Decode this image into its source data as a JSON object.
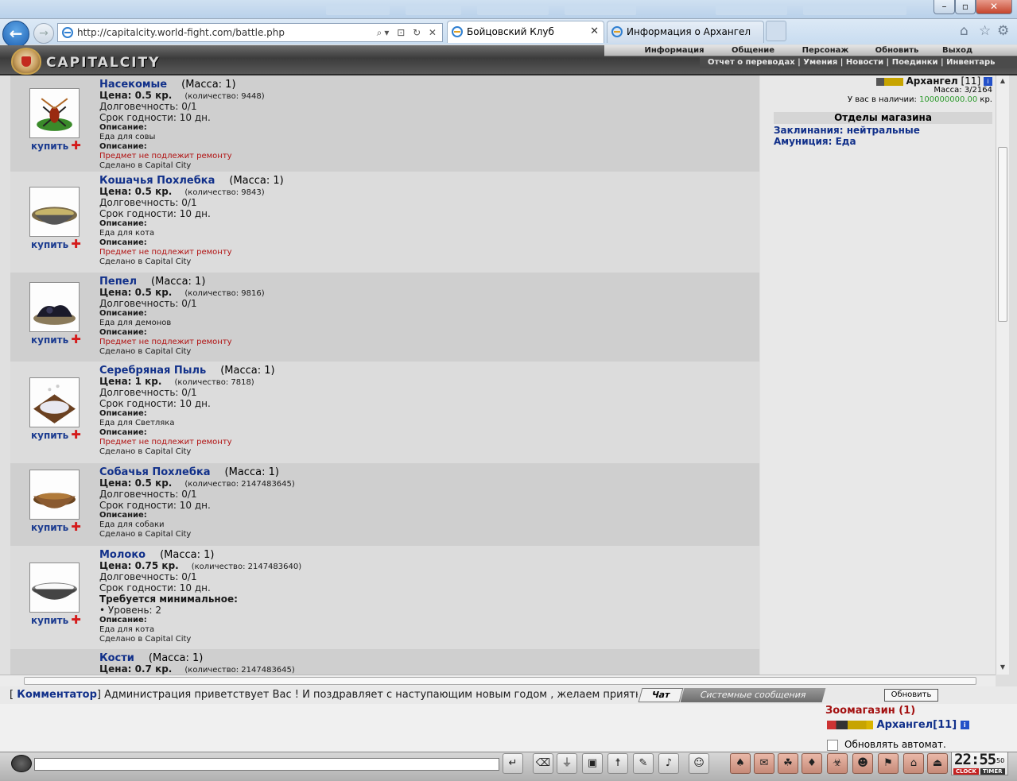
{
  "browser": {
    "address": "http://capitalcity.world-fight.com/battle.php",
    "tabs": [
      "Бойцовский Клуб",
      "Информация о Архангел"
    ]
  },
  "header": {
    "logo": "CAPITALCITY",
    "menu": [
      "Информация",
      "Общение",
      "Персонаж",
      "Обновить",
      "Выход"
    ],
    "submenu": "Отчет о переводах | Умения | Новости | Поединки | Инвентарь"
  },
  "labels": {
    "buy": "купить",
    "mass_prefix": "(Масса: ",
    "mass_suffix": ")",
    "durability": "Долговечность: 0/1",
    "expiry": "Срок годности: 10 дн.",
    "description": "Описание:",
    "no_repair": "Предмет не подлежит ремонту",
    "made_in": "Сделано в Capital City",
    "requires": "Требуется минимальное:",
    "level": "• Уровень: 2"
  },
  "items": [
    {
      "name": "Насекомые",
      "mass": "1",
      "price": "Цена: 0.5 кр.",
      "qty": "(количество: 9448)",
      "food": "Еда для совы"
    },
    {
      "name": "Кошачья Похлебка",
      "mass": "1",
      "price": "Цена: 0.5 кр.",
      "qty": "(количество: 9843)",
      "food": "Еда для кота"
    },
    {
      "name": "Пепел",
      "mass": "1",
      "price": "Цена: 0.5 кр.",
      "qty": "(количество: 9816)",
      "food": "Еда для демонов"
    },
    {
      "name": "Серебряная Пыль",
      "mass": "1",
      "price": "Цена: 1 кр.",
      "qty": "(количество: 7818)",
      "food": "Еда для Светляка"
    },
    {
      "name": "Собачья Похлебка",
      "mass": "1",
      "price": "Цена: 0.5 кр.",
      "qty": "(количество: 2147483645)",
      "food": "Еда для собаки"
    },
    {
      "name": "Молоко",
      "mass": "1",
      "price": "Цена: 0.75 кр.",
      "qty": "(количество: 2147483640)",
      "food": "Еда для кота"
    },
    {
      "name": "Кости",
      "mass": "1",
      "price": "Цена: 0.7 кр.",
      "qty": "(количество: 2147483645)",
      "food": ""
    }
  ],
  "right": {
    "user_name": "Архангел",
    "user_level": "[11]",
    "mass": "Масса: 3/2164",
    "have_label": "У вас в наличии:",
    "money": "100000000.00",
    "money_unit": "кр.",
    "dept_title": "Отделы магазина",
    "depts": [
      "Заклинания: нейтральные",
      "Амуниция: Еда"
    ]
  },
  "chat": {
    "line_prefix": "[ ",
    "author": "Комментатор",
    "line_suffix": "] Администрация приветствует Вас ! И поздравляет с наступающим новым годом , желаем приятно",
    "tab_chat": "Чат",
    "tab_system": "Системные сообщения",
    "refresh": "Обновить",
    "room": "Зоомагазин (1)",
    "room_user": "Архангел[11]",
    "auto_refresh": "Обновлять автомат."
  },
  "clock": {
    "time": "22:55",
    "sec": "50",
    "label1": "CLOCK",
    "label2": "TIMER"
  }
}
